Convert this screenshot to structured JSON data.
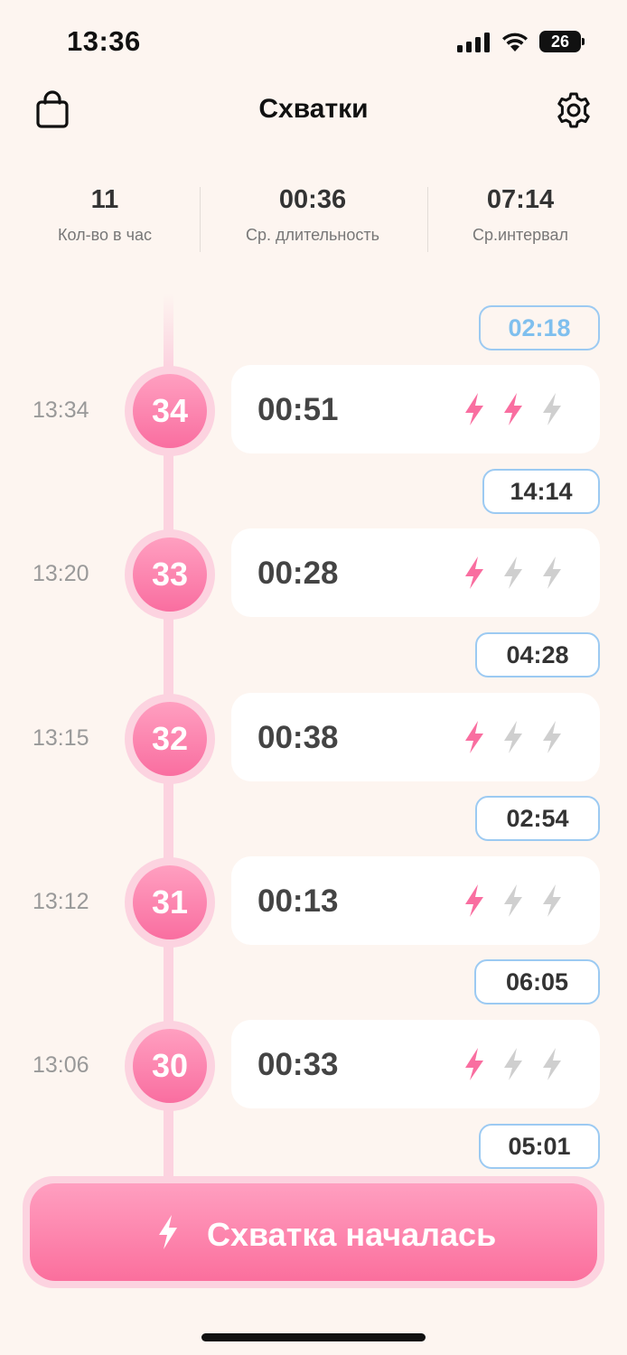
{
  "status_bar": {
    "time": "13:36",
    "battery": "26"
  },
  "nav": {
    "title": "Схватки"
  },
  "stats": [
    {
      "value": "11",
      "label": "Кол-во в час"
    },
    {
      "value": "00:36",
      "label": "Ср. длительность"
    },
    {
      "value": "07:14",
      "label": "Ср.интервал"
    }
  ],
  "current_interval": "02:18",
  "contractions": [
    {
      "number": "34",
      "time": "13:34",
      "duration": "00:51",
      "intensity": 2,
      "interval_after": "14:14"
    },
    {
      "number": "33",
      "time": "13:20",
      "duration": "00:28",
      "intensity": 1,
      "interval_after": "04:28"
    },
    {
      "number": "32",
      "time": "13:15",
      "duration": "00:38",
      "intensity": 1,
      "interval_after": "02:54"
    },
    {
      "number": "31",
      "time": "13:12",
      "duration": "00:13",
      "intensity": 1,
      "interval_after": "06:05"
    },
    {
      "number": "30",
      "time": "13:06",
      "duration": "00:33",
      "intensity": 1,
      "interval_after": "05:01"
    }
  ],
  "colors": {
    "accent_pink": "#f96ea0",
    "bolt_inactive": "#cfcfcf",
    "interval_border": "#9ccaf2",
    "background": "#fdf5f0"
  },
  "start_button": {
    "label": "Схватка началась",
    "icon": "lightning-icon"
  }
}
